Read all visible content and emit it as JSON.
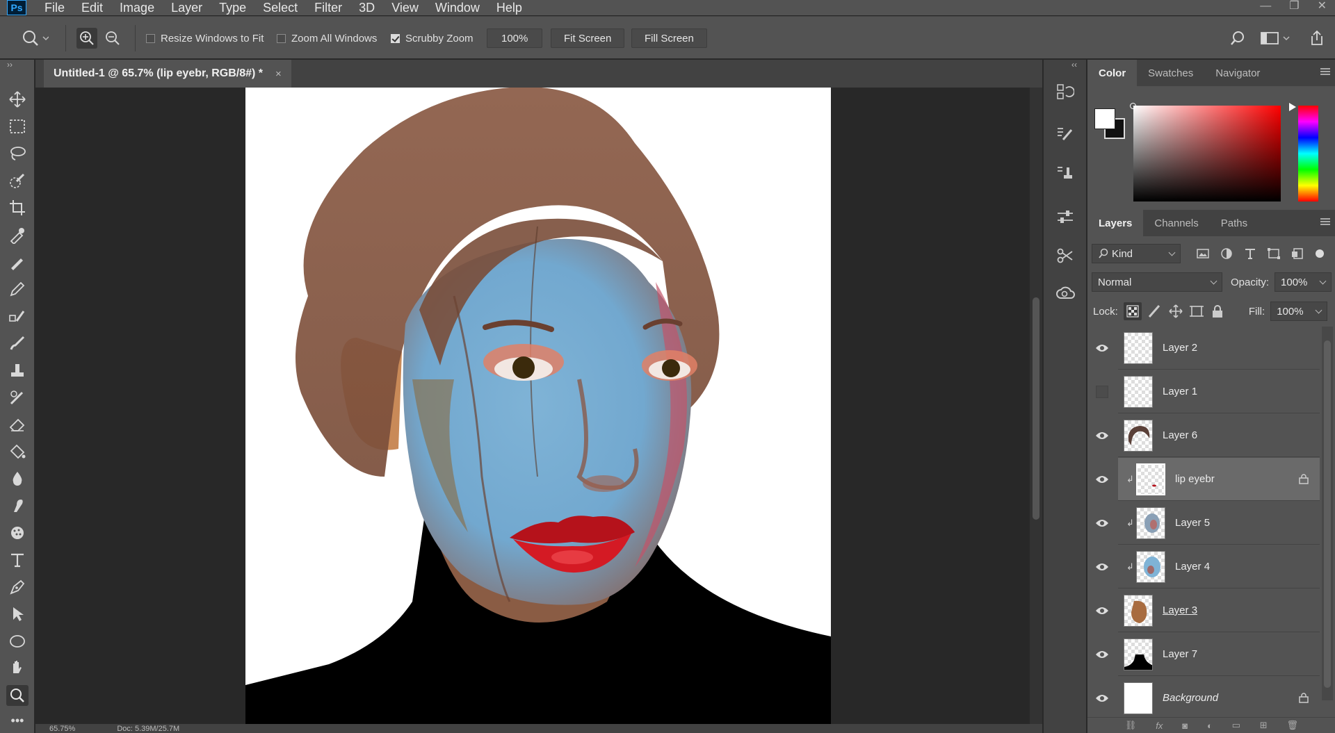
{
  "app": {
    "logo": "Ps"
  },
  "menu": [
    "File",
    "Edit",
    "Image",
    "Layer",
    "Type",
    "Select",
    "Filter",
    "3D",
    "View",
    "Window",
    "Help"
  ],
  "options": {
    "resize_windows": "Resize Windows to Fit",
    "zoom_all": "Zoom All Windows",
    "scrubby_zoom": "Scrubby Zoom",
    "zoom_value": "100%",
    "fit_screen": "Fit Screen",
    "fill_screen": "Fill Screen"
  },
  "document": {
    "tab_title": "Untitled-1 @ 65.7% (lip eyebr, RGB/8#) *",
    "close": "×"
  },
  "status": {
    "zoom": "65.75%",
    "doc": "Doc: 5.39M/25.7M"
  },
  "color_panel": {
    "tabs": [
      "Color",
      "Swatches",
      "Navigator"
    ],
    "foreground": "#ffffff",
    "background": "#111111"
  },
  "layers_panel": {
    "tabs": [
      "Layers",
      "Channels",
      "Paths"
    ],
    "filter_kind": "Kind",
    "blend_mode": "Normal",
    "opacity_label": "Opacity:",
    "opacity_value": "100%",
    "lock_label": "Lock:",
    "fill_label": "Fill:",
    "fill_value": "100%",
    "layers": [
      {
        "name": "Layer 2",
        "visible": true
      },
      {
        "name": "Layer 1",
        "visible": false
      },
      {
        "name": "Layer 6",
        "visible": true
      },
      {
        "name": "lip eyebr",
        "visible": true
      },
      {
        "name": "Layer 5",
        "visible": true
      },
      {
        "name": "Layer 4",
        "visible": true
      },
      {
        "name": "Layer 3",
        "visible": true
      },
      {
        "name": "Layer 7",
        "visible": true
      },
      {
        "name": "Background",
        "visible": true
      }
    ]
  }
}
